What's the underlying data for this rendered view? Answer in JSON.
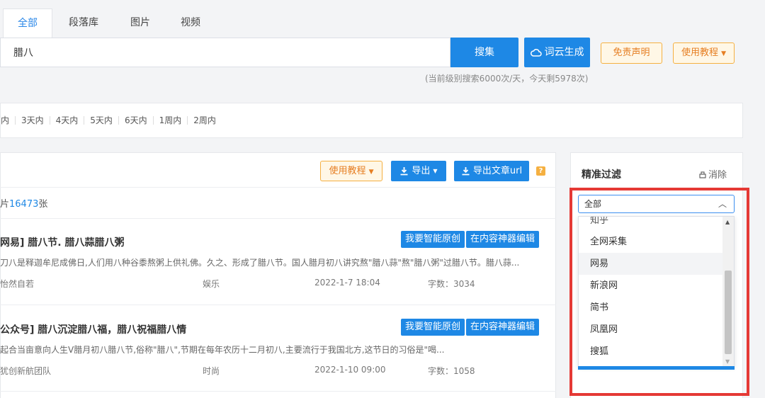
{
  "tabs": [
    {
      "label": "全部",
      "active": true
    },
    {
      "label": "段落库"
    },
    {
      "label": "图片"
    },
    {
      "label": "视频"
    }
  ],
  "search": {
    "value": "腊八",
    "button": "搜集",
    "wordcloud_button": "词云生成",
    "disclaimer_button": "免责声明",
    "tutorial_button": "使用教程",
    "quota_text": "(当前级别搜索6000次/天，今天剩5978次)"
  },
  "time_filters": [
    "内",
    "3天内",
    "4天内",
    "5天内",
    "6天内",
    "1周内",
    "2周内"
  ],
  "toolbar": {
    "tutorial": "使用教程",
    "export": "导出",
    "export_url": "导出文章url",
    "help": "?"
  },
  "result_count": {
    "prefix": "片",
    "number": "16473",
    "suffix": "张"
  },
  "results": [
    {
      "title": "网易] 腊八节. 腊八蒜腊八粥",
      "btn_original": "我要智能原创",
      "btn_edit": "在内容神器编辑",
      "desc": "刀八是释迦牟尼成佛日,人们用八种谷黍熬粥上供礼佛。久之、形成了腊八节。国人腊月初八讲究熬\"腊八蒜\"熬\"腊八粥\"过腊八节。腊八蒜...",
      "author": "怡然自若",
      "category": "娱乐",
      "date": "2022-1-7 18:04",
      "words": "字数：3034"
    },
    {
      "title": "公众号] 腊八沉淀腊八福，腊八祝福腊八情",
      "btn_original": "我要智能原创",
      "btn_edit": "在内容神器编辑",
      "desc": "起合当亩意向人生V腊月初八腊八节,俗称\"腊八\",节期在每年农历十二月初八,主要流行于我国北方,这节日的习俗是\"喝...",
      "author": "犹创新航团队",
      "category": "时尚",
      "date": "2022-1-10 09:00",
      "words": "字数：1058"
    }
  ],
  "filter": {
    "title": "精准过滤",
    "clear": "消除",
    "selected": "全部",
    "options": [
      "知乎",
      "全网采集",
      "网易",
      "新浪网",
      "简书",
      "凤凰网",
      "搜狐"
    ],
    "hovered_index": 2
  },
  "colors": {
    "accent": "#1e88e5",
    "orange": "#f5b041",
    "highlight": "#e53935"
  }
}
